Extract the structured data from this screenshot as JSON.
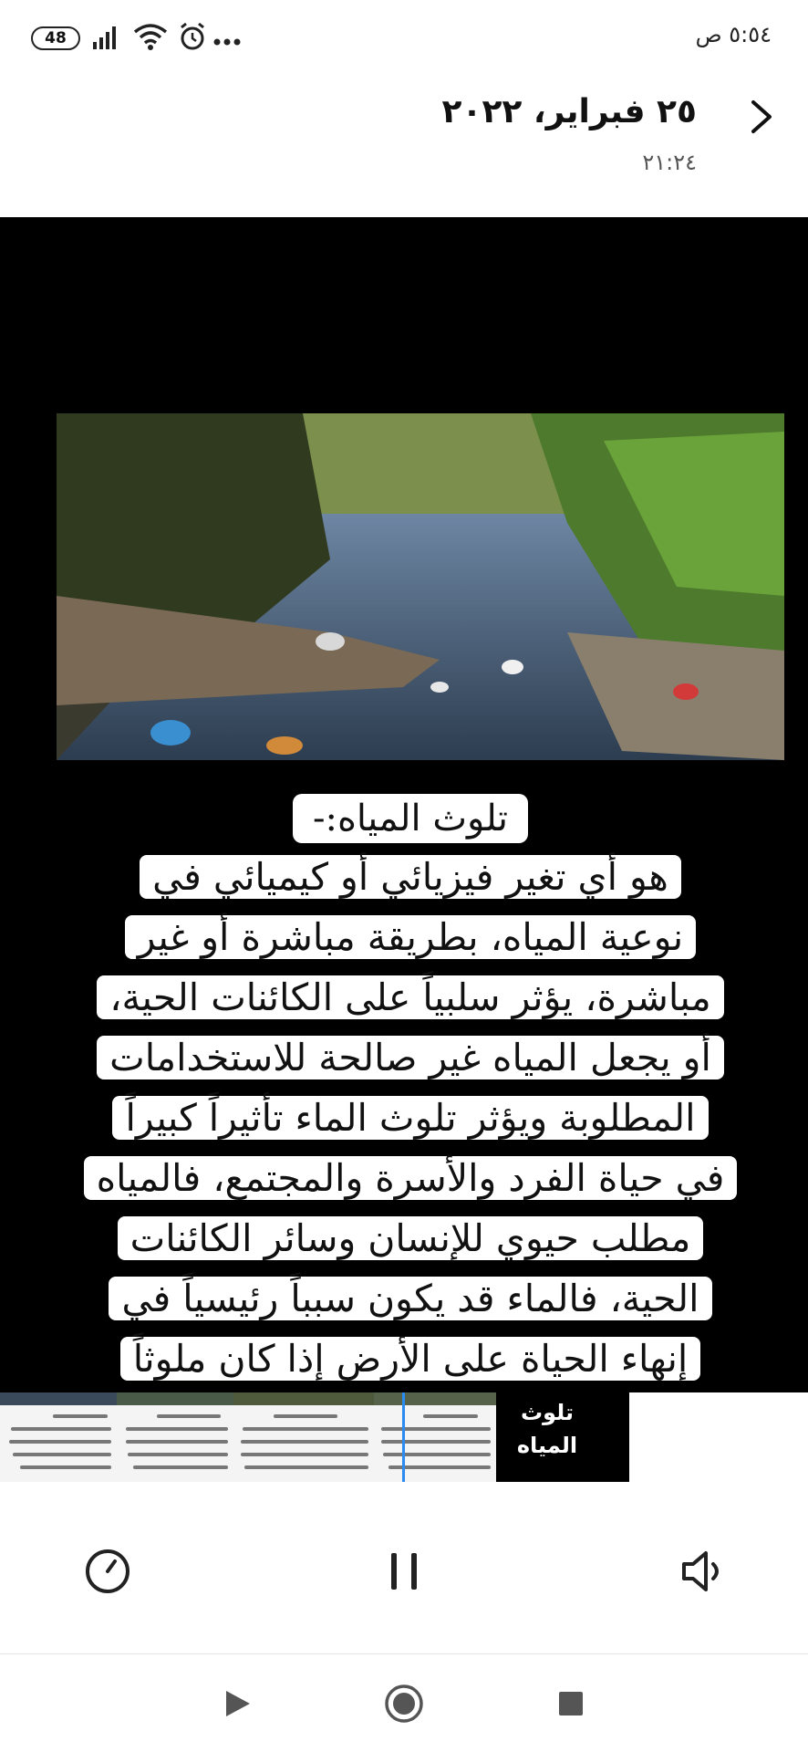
{
  "status_bar": {
    "battery": "48",
    "time": "٥:٥٤ ص",
    "icons": [
      "battery-icon",
      "signal-icon",
      "wifi-icon",
      "alarm-icon",
      "more-dots-icon"
    ]
  },
  "header": {
    "date": "٢٥ فبراير، ٢٠٢٢",
    "time": "٢١:٢٤",
    "back_icon": "chevron-right-icon"
  },
  "content": {
    "title": "تلوث المياه:-",
    "body_lines": [
      "هو أي تغير فيزيائي أو كيميائي في",
      "نوعية المياه، بطريقة مباشرة أو غير",
      "مباشرة، يؤثر سلبياً على الكائنات الحية،",
      "أو يجعل المياه غير صالحة للاستخدامات",
      "المطلوبة ويؤثر تلوث الماء تأثيراً كبيراً",
      "في حياة الفرد والأسرة والمجتمع، فالمياه",
      "مطلب حيوي للإنسان وسائر الكائنات",
      "الحية، فالماء قد يكون سبباً رئيسياً في",
      "إنهاء الحياة على الأرض إذا كان ملوثاً"
    ]
  },
  "timeline": {
    "last_thumb_text": "تلوث المياه"
  },
  "controls": {
    "icons": [
      "speed-gauge-icon",
      "pause-icon",
      "volume-icon"
    ]
  },
  "navbar": {
    "icons": [
      "back-triangle-icon",
      "home-circle-icon",
      "recents-square-icon"
    ]
  },
  "colors": {
    "accent": "#2a8cf0",
    "viewer_bg": "#000000"
  }
}
